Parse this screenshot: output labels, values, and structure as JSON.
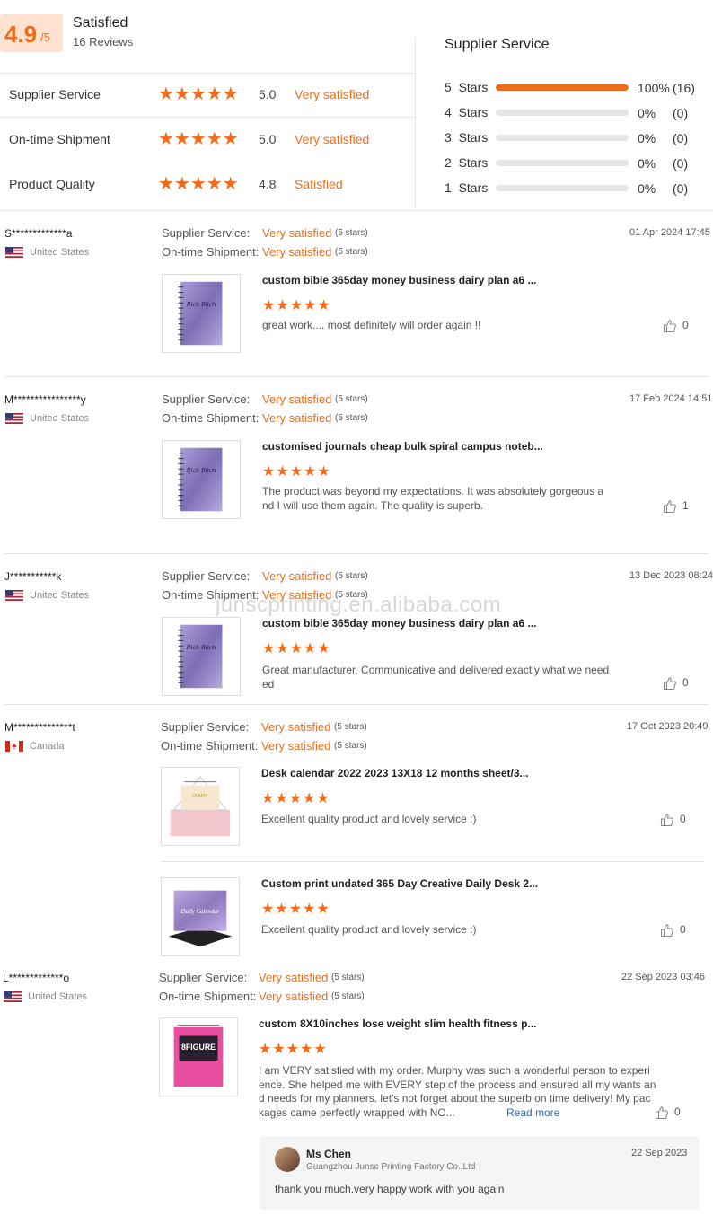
{
  "summary": {
    "score": "4.9",
    "score_max": "/5",
    "label": "Satisfied",
    "review_count": "16 Reviews",
    "metrics": [
      {
        "label": "Supplier Service",
        "stars": 5.0,
        "score": "5.0",
        "verdict": "Very satisfied"
      },
      {
        "label": "On-time Shipment",
        "stars": 5.0,
        "score": "5.0",
        "verdict": "Very satisfied"
      },
      {
        "label": "Product Quality",
        "stars": 4.8,
        "score": "4.8",
        "verdict": "Satisfied"
      }
    ],
    "breakdown_title": "Supplier Service",
    "breakdown": [
      {
        "label": "5  Stars",
        "fraction": 1.0,
        "pct": "100%",
        "count": "(16)"
      },
      {
        "label": "4  Stars",
        "fraction": 0,
        "pct": "0%",
        "count": "(0)"
      },
      {
        "label": "3  Stars",
        "fraction": 0,
        "pct": "0%",
        "count": "(0)"
      },
      {
        "label": "2  Stars",
        "fraction": 0,
        "pct": "0%",
        "count": "(0)"
      },
      {
        "label": "1  Stars",
        "fraction": 0,
        "pct": "0%",
        "count": "(0)"
      }
    ]
  },
  "labels": {
    "supplier_service": "Supplier Service:",
    "ontime_shipment": "On-time Shipment:",
    "very_satisfied": "Very satisfied",
    "five_stars": "(5 stars)"
  },
  "reviews": [
    {
      "name": "S*************a",
      "country": "United States",
      "date": "01 Apr 2024 17:45",
      "items": [
        {
          "product": "custom bible 365day money business dairy plan a6 ...",
          "text": "great work.... most definitely will order again !!",
          "likes": "0"
        }
      ]
    },
    {
      "name": "M****************y",
      "country": "United States",
      "date": "17 Feb 2024 14:51",
      "items": [
        {
          "product": "customised journals cheap bulk spiral campus noteb...",
          "text_line1": "The product was beyond my expectations. It was absolutely gorgeous a",
          "text_line2": "nd I will use them again. The quality is superb.",
          "likes": "1"
        }
      ]
    },
    {
      "name": "J***********k",
      "country": "United States",
      "date": "13 Dec 2023 08:24",
      "items": [
        {
          "product": "custom bible 365day money business dairy plan a6 ...",
          "text_line1": "Great manufacturer. Communicative and delivered exactly what we need",
          "text_line2": "ed",
          "likes": "0"
        }
      ]
    },
    {
      "name": "M**************t",
      "country": "Canada",
      "date": "17 Oct 2023 20:49",
      "items": [
        {
          "product": "Desk calendar 2022 2023 13X18 12 months sheet/3...",
          "text": "Excellent quality product and lovely service :)",
          "likes": "0"
        },
        {
          "product": "Custom print undated 365 Day Creative Daily Desk 2...",
          "text": "Excellent quality product and lovely service :)",
          "likes": "0"
        }
      ]
    },
    {
      "name": "L*************o",
      "country": "United States",
      "date": "22 Sep 2023 03:46",
      "items": [
        {
          "product": "custom 8X10inches lose weight slim health fitness p...",
          "text_line1": "I am VERY satisfied with my order. Murphy was such a wonderful person to experi",
          "text_line2": "ence. She helped me with EVERY step of the process and ensured all my wants an",
          "text_line3": "d needs for my planners. let's not forget about the superb on time delivery! My pac",
          "text_line4": "kages came perfectly wrapped with NO...",
          "read_more": "Read more",
          "likes": "0"
        }
      ]
    }
  ],
  "reply": {
    "name": "Ms Chen",
    "company": "Guangzhou Junsc Printing Factory Co.,Ltd",
    "date": "22 Sep 2023",
    "text": "thank you much.very happy work with you again"
  },
  "watermark": "junscprinting.en.alibaba.com",
  "colors": {
    "accent": "#f06c1a",
    "score_bg": "#fde3cf"
  }
}
